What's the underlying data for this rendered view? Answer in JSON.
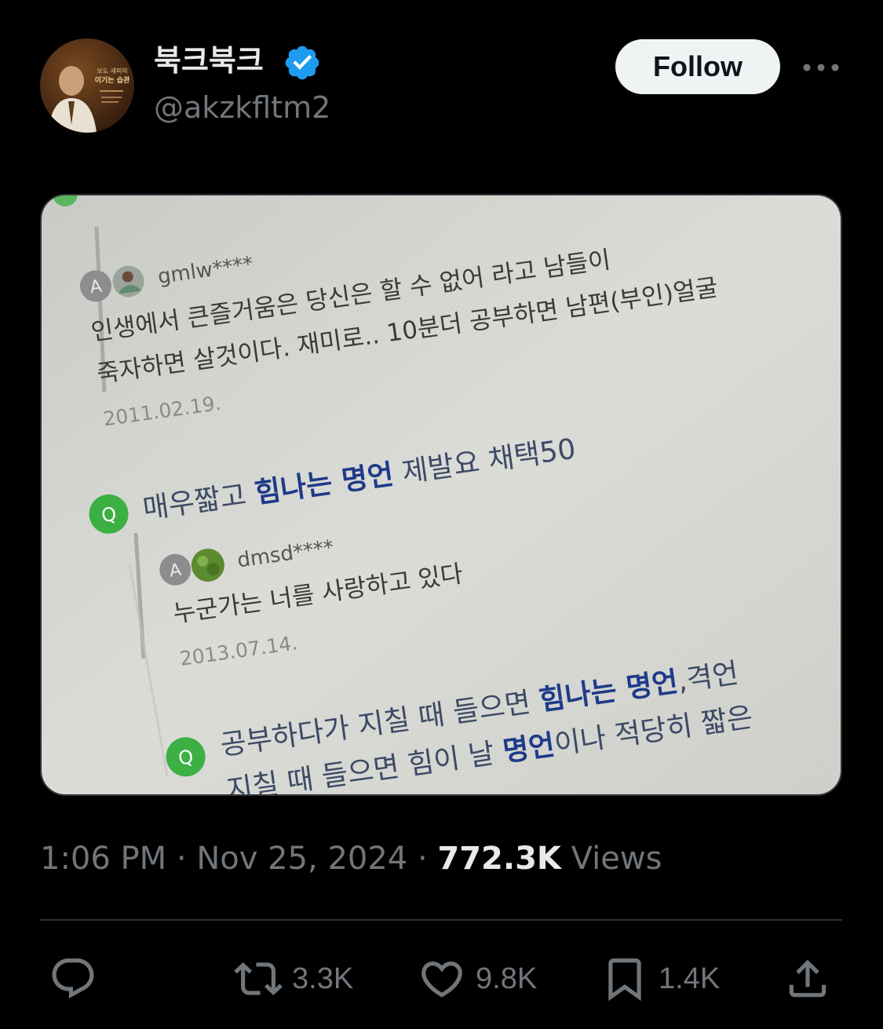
{
  "author": {
    "display_name": "북크북크",
    "handle": "@akzkfltm2",
    "avatar_text": [
      "보도 섀퍼의",
      "이기는 습관"
    ]
  },
  "follow_label": "Follow",
  "media": {
    "entries": [
      {
        "type": "answer",
        "user": "gmlw****",
        "lines": [
          "인생에서 큰즐거움은 당신은 할 수 없어 라고 남들이",
          "죽자하면 살것이다. 재미로.. 10분더 공부하면 남편(부인)얼굴"
        ],
        "date": "2011.02.19."
      },
      {
        "type": "question",
        "badge": "Q",
        "parts": [
          "매우짧고 ",
          "힘나는 명언",
          " 제발요 채택50"
        ]
      },
      {
        "type": "answer",
        "user": "dmsd****",
        "lines": [
          "누군가는 너를 사랑하고 있다"
        ],
        "date": "2013.07.14."
      },
      {
        "type": "question",
        "badge": "Q",
        "line1": [
          "공부하다가 지칠 때 들으면 ",
          "힘나는 명언",
          ",격언"
        ],
        "line2": [
          "지칠 때 들으면 힘이 날 ",
          "명언",
          "이나 적당히 짧은"
        ]
      }
    ],
    "answer_badge": "A"
  },
  "meta": {
    "time": "1:06 PM",
    "separator": "·",
    "date": "Nov 25, 2024",
    "views_count": "772.3K",
    "views_label": "Views"
  },
  "actions": {
    "replies": "",
    "retweets": "3.3K",
    "likes": "9.8K",
    "bookmarks": "1.4K"
  },
  "colors": {
    "background": "#000000",
    "verified": "#1d9bf0",
    "secondary_text": "#71767b",
    "question_badge": "#3cb043",
    "highlight_text": "#1e3a8a"
  },
  "icons": [
    "verified-badge-icon",
    "more-icon",
    "reply-icon",
    "retweet-icon",
    "like-icon",
    "bookmark-icon",
    "share-icon"
  ]
}
